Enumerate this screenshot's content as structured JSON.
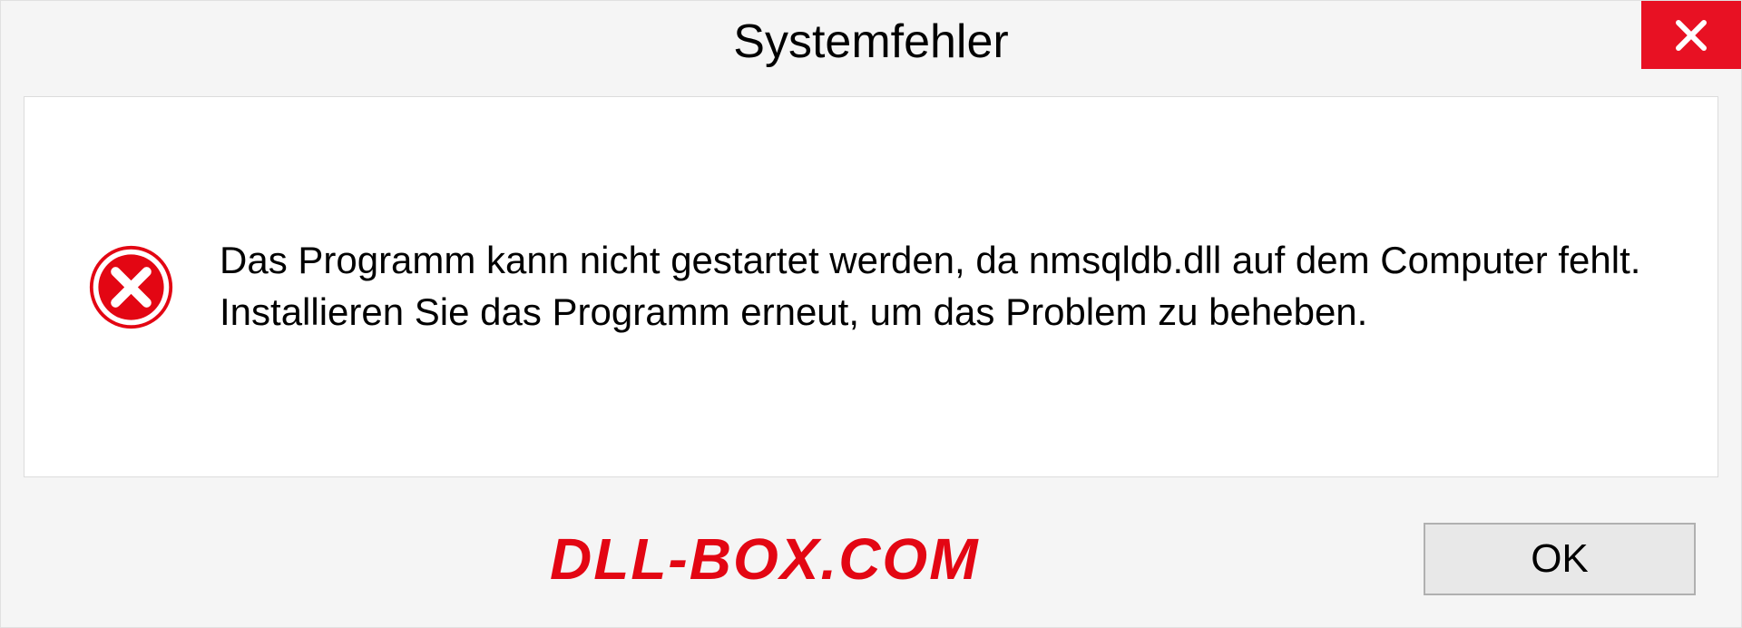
{
  "dialog": {
    "title": "Systemfehler",
    "message": "Das Programm kann nicht gestartet werden, da nmsqldb.dll auf dem Computer fehlt. Installieren Sie das Programm erneut, um das Problem zu beheben.",
    "ok_label": "OK"
  },
  "watermark": "DLL-BOX.COM"
}
